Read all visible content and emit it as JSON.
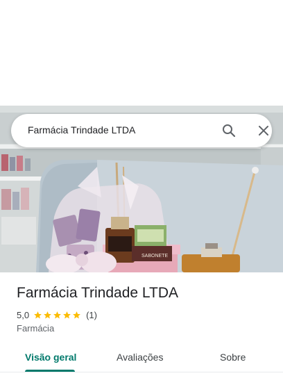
{
  "search": {
    "query": "Farmácia Trindade LTDA"
  },
  "place": {
    "name": "Farmácia Trindade LTDA",
    "rating": "5,0",
    "stars": 5,
    "reviews": "(1)",
    "category": "Farmácia"
  },
  "photo": {
    "labels": {
      "bottle": "SABONETE"
    }
  },
  "tabs": [
    {
      "label": "Visão geral",
      "active": true
    },
    {
      "label": "Avaliações",
      "active": false
    },
    {
      "label": "Sobre",
      "active": false
    }
  ],
  "colors": {
    "accent": "#00796b",
    "star": "#fbbc04"
  }
}
